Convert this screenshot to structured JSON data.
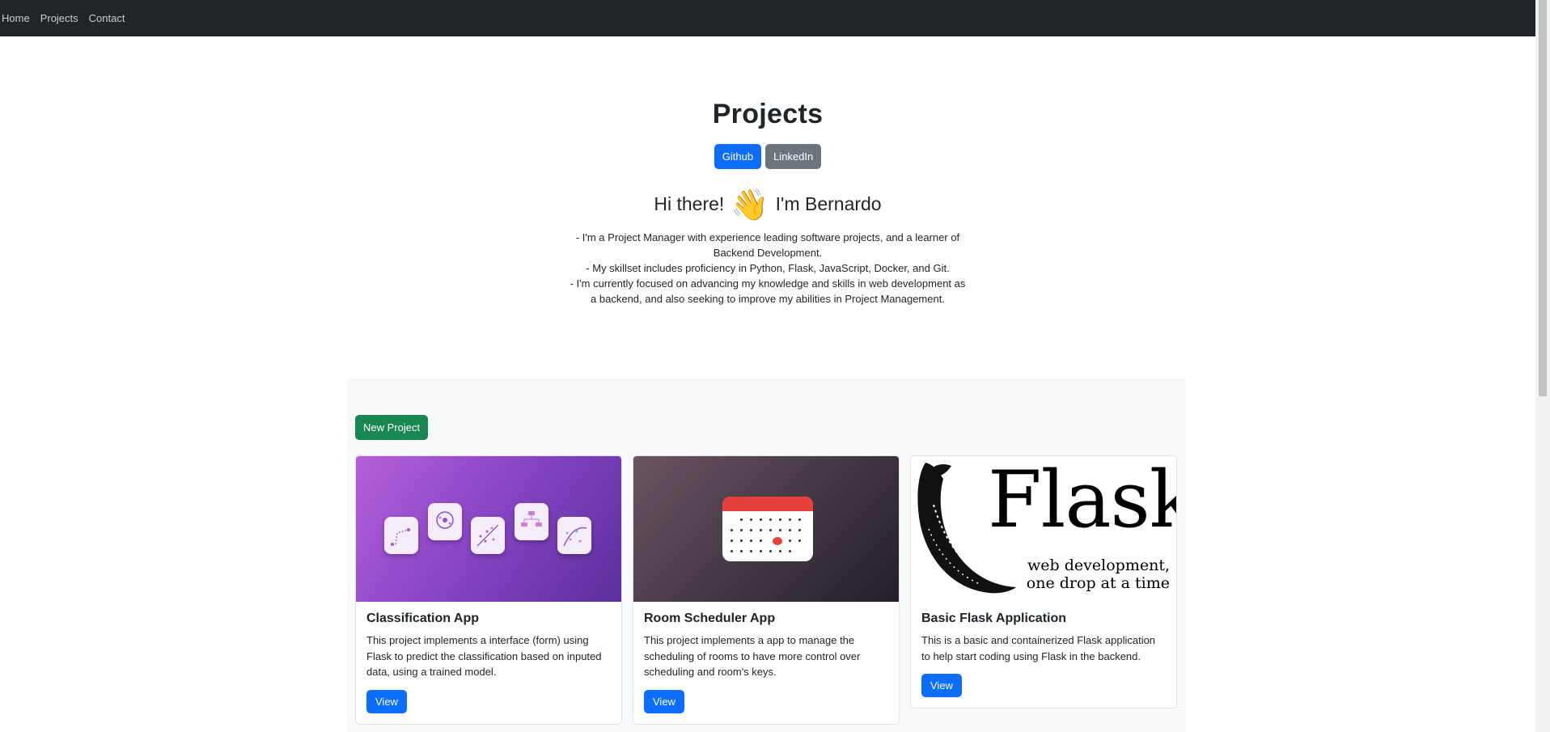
{
  "nav": {
    "items": [
      "Home",
      "Projects",
      "Contact"
    ]
  },
  "hero": {
    "title": "Projects",
    "github_label": "Github",
    "linkedin_label": "LinkedIn",
    "greeting_start": "Hi there!",
    "greeting_emoji": "👋",
    "greeting_end": "I'm Bernardo",
    "bio": [
      "- I'm a Project Manager with experience leading software projects, and a learner of Backend Development.",
      "- My skillset includes proficiency in Python, Flask, JavaScript, Docker, and Git.",
      "- I'm currently focused on advancing my knowledge and skills in web development as a backend, and also seeking to improve my abilities in Project Management."
    ]
  },
  "projects": {
    "new_label": "New Project",
    "cards": [
      {
        "title": "Classification App",
        "text": "This project implements a interface (form) using Flask to predict the classification based on inputed data, using a trained model.",
        "button": "View",
        "image": "ml-icons-image"
      },
      {
        "title": "Room Scheduler App",
        "text": "This project implements a app to manage the scheduling of rooms to have more control over scheduling and room's keys.",
        "button": "View",
        "image": "calendar-image"
      },
      {
        "title": "Basic Flask Application",
        "text": "This is a basic and containerized Flask application to help start coding using Flask in the backend.",
        "button": "View",
        "image": "flask-logo-image",
        "logo_text": "Flask",
        "logo_tagline": [
          "web development,",
          "one drop at a time"
        ]
      }
    ]
  },
  "colors": {
    "navbar": "#212529",
    "primary": "#0d6efd",
    "secondary": "#6c757d",
    "success": "#198754"
  }
}
